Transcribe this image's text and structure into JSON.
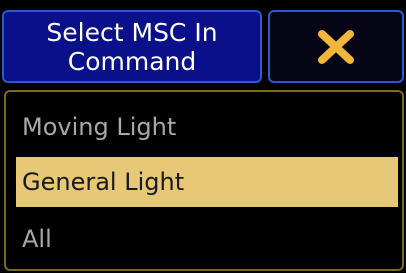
{
  "dialog": {
    "title": "Select MSC In\nCommand",
    "close_icon": "close-x-icon",
    "accent_color": "#f2b63a"
  },
  "options": [
    {
      "label": "Moving Light",
      "selected": false
    },
    {
      "label": "General Light",
      "selected": true
    },
    {
      "label": "All",
      "selected": false
    }
  ],
  "colors": {
    "title_bg": "#0a0f8a",
    "button_border": "#2a5cc8",
    "selected_bg": "#e6c877",
    "panel_border": "#7a6a20",
    "item_text": "#a8a8a8"
  }
}
